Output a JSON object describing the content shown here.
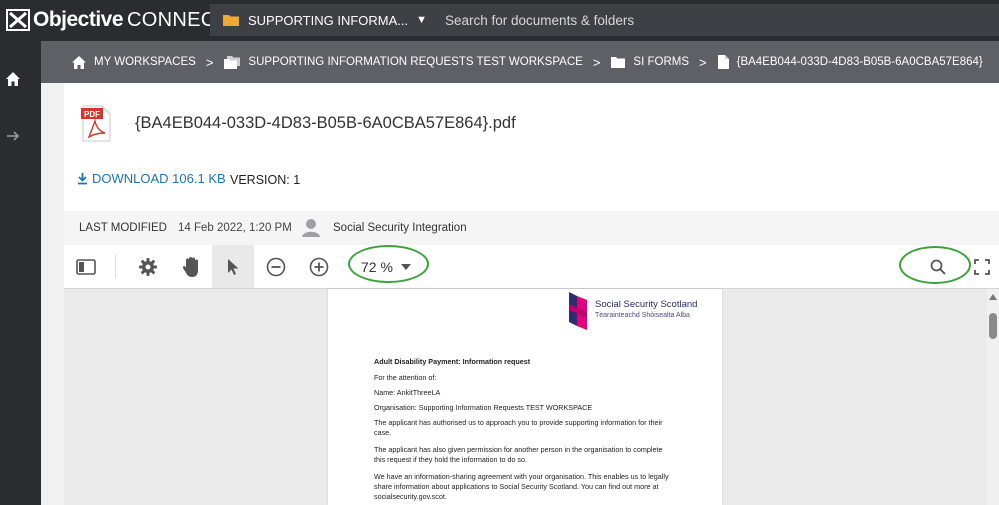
{
  "app": {
    "logo_strong": "Objective",
    "logo_light": "CONNECT"
  },
  "topbar": {
    "workspace_select": "SUPPORTING INFORMA...",
    "search_placeholder": "Search for documents & folders"
  },
  "breadcrumb": {
    "items": [
      {
        "label": "MY WORKSPACES",
        "icon": "home-icon"
      },
      {
        "label": "SUPPORTING INFORMATION REQUESTS TEST WORKSPACE",
        "icon": "workspace-folder-icon"
      },
      {
        "label": "SI FORMS",
        "icon": "folder-icon"
      },
      {
        "label": "{BA4EB044-033D-4D83-B05B-6A0CBA57E864}",
        "icon": "file-icon"
      }
    ],
    "separator": ">"
  },
  "file": {
    "type_badge": "PDF",
    "title": "{BA4EB044-033D-4D83-B05B-6A0CBA57E864}.pdf",
    "download_label": "DOWNLOAD 106.1 KB",
    "version_label": "VERSION: 1"
  },
  "meta": {
    "last_modified_label": "LAST MODIFIED",
    "last_modified_value": "14 Feb 2022, 1:20 PM",
    "modified_by": "Social Security Integration"
  },
  "toolbar": {
    "zoom_value": "72 %"
  },
  "document": {
    "brand_name": "Social Security Scotland",
    "brand_gaelic": "Tèarainteachd Shòisealta Alba",
    "heading": "Adult Disability Payment: Information request",
    "lines": [
      "For the attention of:",
      "Name: AnkitThreeLA",
      "Organisation: Supporting Information Requests TEST WORKSPACE",
      "The applicant has authorised us to approach you to provide supporting information for their",
      "case.",
      "The applicant has also given permission for another person in the organisation to complete",
      "this request if they hold the information to do so.",
      "We have an information-sharing agreement with your organisation. This enables us to legally",
      "share information about applications to Social Security Scotland. You can find out more at",
      "socialsecurity.gov.scot."
    ]
  },
  "colors": {
    "topbar": "#2a2d30",
    "breadcrumb_bar": "#5d6166",
    "link_blue": "#1b75bb",
    "annotation_green": "#3ba13b",
    "pdf_red": "#d9342b",
    "brand_magenta": "#e4007c"
  }
}
